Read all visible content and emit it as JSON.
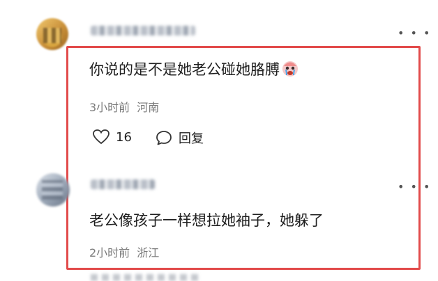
{
  "comments": [
    {
      "text": "你说的是不是她老公碰她胳膊",
      "emoji_icon": "crying-face-emoji",
      "time": "3小时前",
      "location": "河南",
      "likes": "16",
      "reply_label": "回复"
    },
    {
      "text": "老公像孩子一样想拉她袖子，她躲了",
      "time": "2小时前",
      "location": "浙江"
    }
  ],
  "colors": {
    "highlight_border": "#e24b4b",
    "meta_text": "#7a7a7a"
  },
  "icons": {
    "more": "more-dots-icon",
    "like": "heart-outline-icon",
    "reply": "speech-bubble-icon"
  }
}
